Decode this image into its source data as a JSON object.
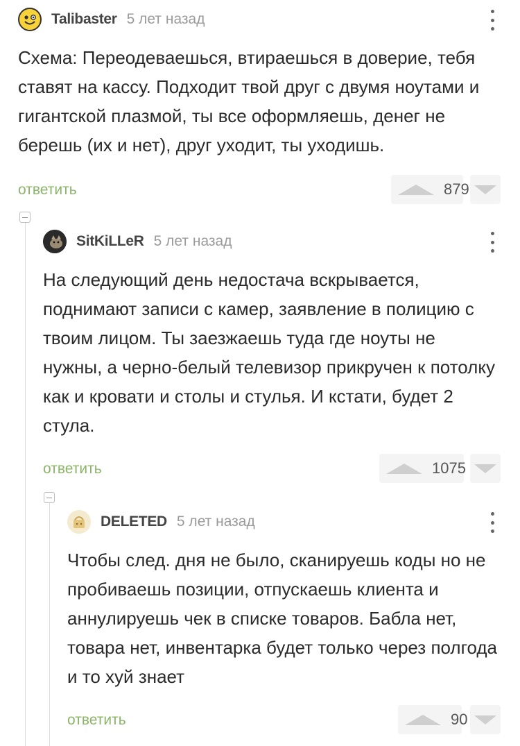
{
  "comments": [
    {
      "author": "Talibaster",
      "time": "5 лет назад",
      "avatar_icon": "smiley-face-icon",
      "text": "Схема:  Переодеваешься, втираешься в доверие, тебя ставят на кассу. Подходит твой друг с двумя ноутами и гигантской плазмой, ты все оформляешь, денег не берешь (их и нет), друг уходит, ты уходишь.",
      "reply_label": "ответить",
      "score": "879"
    },
    {
      "author": "SitKiLLeR",
      "time": "5 лет назад",
      "avatar_icon": "cat-photo-icon",
      "text": "На следующий день недостача вскрывается, поднимают записи с камер, заявление в полицию с твоим лицом. Ты заезжаешь туда где ноуты не нужны, а черно-белый телевизор прикручен к потолку как и кровати и столы и стулья. И кстати, будет 2 стула.",
      "reply_label": "ответить",
      "score": "1075"
    },
    {
      "author": "DELETED",
      "time": "5 лет назад",
      "avatar_icon": "deleted-user-icon",
      "text": "Чтобы след. дня не было, сканируешь коды но не пробиваешь позиции, отпускаешь клиента и аннулируешь чек в списке товаров. Бабла нет, товара нет, инвентарка будет только через полгода и то хуй знает",
      "reply_label": "ответить",
      "score": "90"
    }
  ],
  "colors": {
    "reply": "#8cb469",
    "vote_bg": "#f4f4f4",
    "arrow": "#cfcfcf"
  }
}
